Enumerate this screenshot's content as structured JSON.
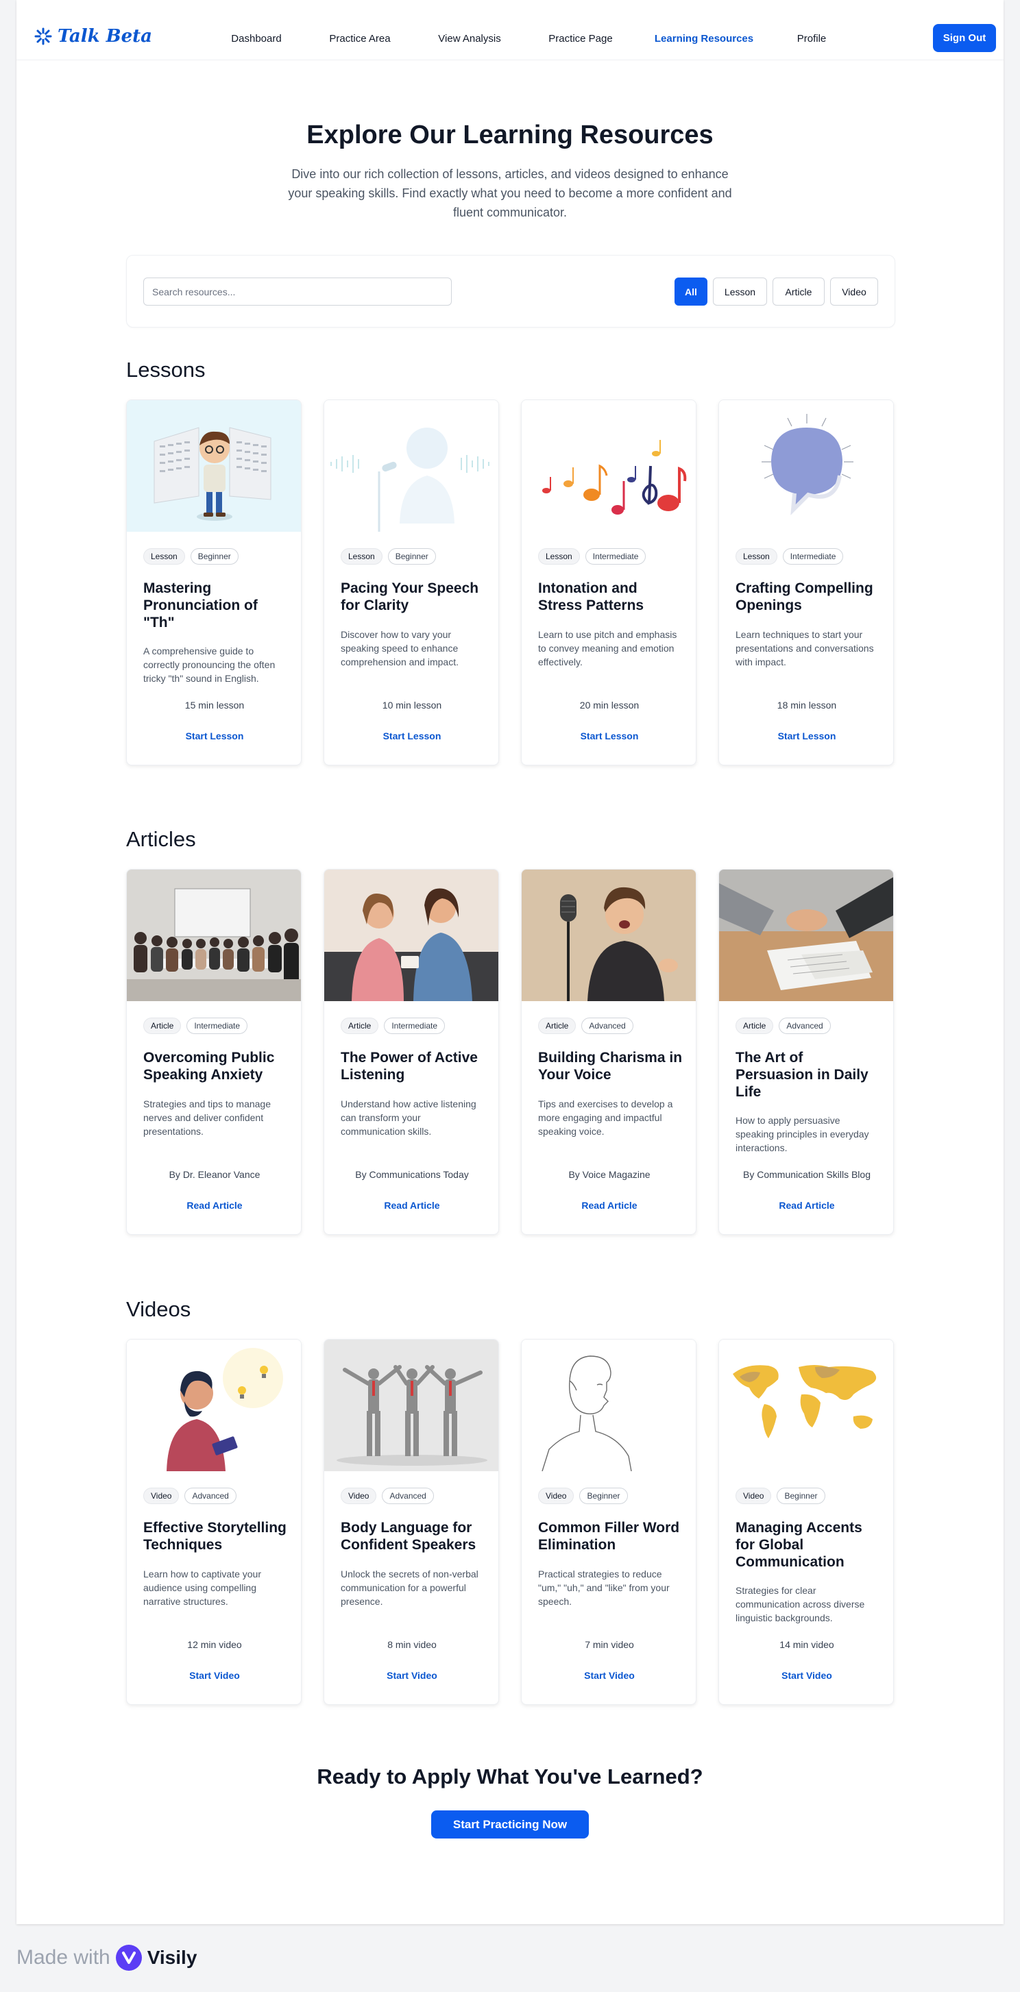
{
  "nav": {
    "brand": "Talk Beta",
    "links": [
      {
        "label": "Dashboard",
        "active": false
      },
      {
        "label": "Practice Area",
        "active": false
      },
      {
        "label": "View Analysis",
        "active": false
      },
      {
        "label": "Practice Page",
        "active": false
      },
      {
        "label": "Learning Resources",
        "active": true
      },
      {
        "label": "Profile",
        "active": false
      }
    ],
    "signout_label": "Sign Out"
  },
  "hero": {
    "title": "Explore Our Learning Resources",
    "subtitle": "Dive into our rich collection of lessons, articles, and videos designed to enhance your speaking skills. Find exactly what you need to become a more confident and fluent communicator."
  },
  "filter": {
    "search_placeholder": "Search resources...",
    "search_value": "",
    "buttons": [
      "All",
      "Lesson",
      "Article",
      "Video"
    ],
    "active": "All"
  },
  "sections": [
    {
      "title": "Lessons",
      "cards": [
        {
          "type": "Lesson",
          "level": "Beginner",
          "title": "Mastering Pronunciation of \"Th\"",
          "desc": "A comprehensive guide to correctly pronouncing the often tricky \"th\" sound in English.",
          "meta": "15 min lesson",
          "cta": "Start Lesson",
          "image": "cartoon-person-icon"
        },
        {
          "type": "Lesson",
          "level": "Beginner",
          "title": "Pacing Your Speech for Clarity",
          "desc": "Discover how to vary your speaking speed to enhance comprehension and impact.",
          "meta": "10 min lesson",
          "cta": "Start Lesson",
          "image": "microphone-waveform-icon"
        },
        {
          "type": "Lesson",
          "level": "Intermediate",
          "title": "Intonation and Stress Patterns",
          "desc": "Learn to use pitch and emphasis to convey meaning and emotion effectively.",
          "meta": "20 min lesson",
          "cta": "Start Lesson",
          "image": "music-notes-icon"
        },
        {
          "type": "Lesson",
          "level": "Intermediate",
          "title": "Crafting Compelling Openings",
          "desc": "Learn techniques to start your presentations and conversations with impact.",
          "meta": "18 min lesson",
          "cta": "Start Lesson",
          "image": "speech-bubble-icon"
        }
      ]
    },
    {
      "title": "Articles",
      "cards": [
        {
          "type": "Article",
          "level": "Intermediate",
          "title": "Overcoming Public Speaking Anxiety",
          "desc": "Strategies and tips to manage nerves and deliver confident presentations.",
          "meta": "By Dr. Eleanor Vance",
          "cta": "Read Article",
          "image": "group-meeting-photo"
        },
        {
          "type": "Article",
          "level": "Intermediate",
          "title": "The Power of Active Listening",
          "desc": "Understand how active listening can transform your communication skills.",
          "meta": "By Communications Today",
          "cta": "Read Article",
          "image": "two-women-talking-photo"
        },
        {
          "type": "Article",
          "level": "Advanced",
          "title": "Building Charisma in Your Voice",
          "desc": "Tips and exercises to develop a more engaging and impactful speaking voice.",
          "meta": "By Voice Magazine",
          "cta": "Read Article",
          "image": "singer-microphone-photo"
        },
        {
          "type": "Article",
          "level": "Advanced",
          "title": "The Art of Persuasion in Daily Life",
          "desc": "How to apply persuasive speaking principles in everyday interactions.",
          "meta": "By Communication Skills Blog",
          "cta": "Read Article",
          "image": "handshake-photo"
        }
      ]
    },
    {
      "title": "Videos",
      "cards": [
        {
          "type": "Video",
          "level": "Advanced",
          "title": "Effective Storytelling Techniques",
          "desc": "Learn how to captivate your audience using compelling narrative structures.",
          "meta": "12 min video",
          "cta": "Start Video",
          "image": "storyteller-lightbulb-icon"
        },
        {
          "type": "Video",
          "level": "Advanced",
          "title": "Body Language for Confident Speakers",
          "desc": "Unlock the secrets of non-verbal communication for a powerful presence.",
          "meta": "8 min video",
          "cta": "Start Video",
          "image": "three-figures-icon"
        },
        {
          "type": "Video",
          "level": "Beginner",
          "title": "Common Filler Word Elimination",
          "desc": "Practical strategies to reduce \"um,\" \"uh,\" and \"like\" from your speech.",
          "meta": "7 min video",
          "cta": "Start Video",
          "image": "line-portrait-icon"
        },
        {
          "type": "Video",
          "level": "Beginner",
          "title": "Managing Accents for Global Communication",
          "desc": "Strategies for clear communication across diverse linguistic backgrounds.",
          "meta": "14 min video",
          "cta": "Start Video",
          "image": "world-map-icon"
        }
      ]
    }
  ],
  "cta": {
    "title": "Ready to Apply What You've Learned?",
    "button_label": "Start Practicing Now"
  },
  "footer": {
    "made_with": "Made with",
    "brand": "Visily"
  },
  "colors": {
    "primary": "#0b5cf0",
    "link": "#0b57d0",
    "text": "#111827",
    "muted": "#4b5563"
  }
}
